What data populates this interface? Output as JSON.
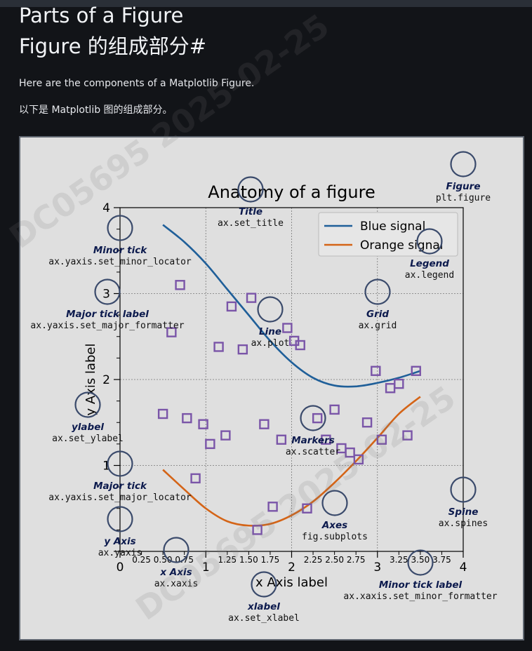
{
  "heading": {
    "title_en": "Parts of a Figure",
    "title_zh": "Figure 的组成部分#"
  },
  "paragraphs": {
    "en": "Here are the components of a Matplotlib Figure.",
    "zh": "以下是 Matplotlib 图的组成部分。"
  },
  "watermarks": [
    "DC05695 2025-02-25",
    "DC05695 2025-02-25"
  ],
  "colors": {
    "page_bg": "#121418",
    "figure_bg": "#dfdfdf",
    "blue": "#1f5f99",
    "orange": "#d46417",
    "marker": "#7a55a8",
    "annotation_circle": "#3a4a6b",
    "annotation_title": "#0c1a4d"
  },
  "chart_data": {
    "type": "line",
    "title": "Anatomy of a figure",
    "xlabel": "x Axis label",
    "ylabel": "y Axis label",
    "xlim": [
      0,
      4
    ],
    "ylim": [
      0,
      4
    ],
    "x_major_ticks": [
      "0",
      "1",
      "2",
      "3",
      "4"
    ],
    "x_minor_tick_labels": [
      "0.25",
      "0.50",
      "0.75",
      "1.25",
      "1.50",
      "1.75",
      "2.25",
      "2.50",
      "2.75",
      "3.25",
      "3.50",
      "3.75"
    ],
    "y_major_ticks": [
      "",
      "1",
      "2",
      "3",
      "4"
    ],
    "grid": true,
    "legend": {
      "placement": "top-right",
      "entries": [
        "Blue signal",
        "Orange signal"
      ]
    },
    "series": [
      {
        "name": "Blue signal",
        "color": "#1f5f99",
        "x": [
          0.5,
          0.75,
          1.0,
          1.25,
          1.5,
          1.75,
          2.0,
          2.25,
          2.5,
          2.75,
          3.0,
          3.25,
          3.5
        ],
        "y": [
          3.8,
          3.6,
          3.35,
          3.05,
          2.75,
          2.45,
          2.2,
          2.02,
          1.93,
          1.92,
          1.96,
          2.02,
          2.1
        ]
      },
      {
        "name": "Orange signal",
        "color": "#d46417",
        "x": [
          0.5,
          0.75,
          1.0,
          1.25,
          1.5,
          1.75,
          2.0,
          2.25,
          2.5,
          2.75,
          3.0,
          3.25,
          3.5
        ],
        "y": [
          0.95,
          0.72,
          0.5,
          0.35,
          0.3,
          0.32,
          0.42,
          0.58,
          0.8,
          1.05,
          1.32,
          1.6,
          1.8
        ]
      }
    ],
    "scatter": {
      "name": "Markers",
      "x": [
        0.5,
        0.6,
        0.7,
        0.78,
        0.88,
        0.97,
        1.05,
        1.15,
        1.23,
        1.3,
        1.43,
        1.53,
        1.6,
        1.68,
        1.78,
        1.88,
        1.95,
        2.03,
        2.1,
        2.18,
        2.3,
        2.4,
        2.5,
        2.58,
        2.68,
        2.78,
        2.88,
        2.98,
        3.05,
        3.15,
        3.25,
        3.35,
        3.45
      ],
      "y": [
        1.6,
        2.55,
        3.1,
        1.55,
        0.85,
        1.48,
        1.25,
        2.38,
        1.35,
        2.85,
        2.35,
        2.95,
        0.25,
        1.48,
        0.52,
        1.3,
        2.6,
        2.45,
        2.4,
        0.5,
        1.55,
        1.3,
        1.65,
        1.2,
        1.15,
        1.07,
        1.5,
        2.1,
        1.3,
        1.9,
        1.95,
        1.35,
        2.1
      ]
    },
    "annotations": [
      {
        "title": "Figure",
        "code": "plt.figure",
        "cx": 3.72,
        "cy": 4.05
      },
      {
        "title": "Title",
        "code": "ax.set_title",
        "cx": 1.44,
        "cy": 4.25
      },
      {
        "title": "Legend",
        "code": "ax.legend",
        "cx": 3.65,
        "cy": 3.85
      },
      {
        "title": "Minor tick",
        "code": "ax.yaxis.set_minor_locator",
        "cx": 0.0,
        "cy": 3.75
      },
      {
        "title": "Major tick label",
        "code": "ax.yaxis.set_major_formatter",
        "cx": -0.15,
        "cy": 3.0
      },
      {
        "title": "Grid",
        "code": "ax.grid",
        "cx": 3.0,
        "cy": 3.0
      },
      {
        "title": "Line",
        "code": "ax.plot",
        "cx": 1.75,
        "cy": 2.75
      },
      {
        "title": "ylabel",
        "code": "ax.set_ylabel",
        "cx": -0.4,
        "cy": 1.75
      },
      {
        "title": "Markers",
        "code": "ax.scatter",
        "cx": 2.25,
        "cy": 1.5
      },
      {
        "title": "Major tick",
        "code": "ax.yaxis.set_major_locator",
        "cx": 0.0,
        "cy": 1.0
      },
      {
        "title": "Axes",
        "code": "fig.subplots",
        "cx": 2.5,
        "cy": 0.5
      },
      {
        "title": "Spine",
        "code": "ax.spines",
        "cx": 4.0,
        "cy": 0.5
      },
      {
        "title": "y Axis",
        "code": "ax.yaxis",
        "cx": 0.0,
        "cy": 0.25
      },
      {
        "title": "x Axis",
        "code": "ax.xaxis",
        "cx": 0.65,
        "cy": -0.07
      },
      {
        "title": "Minor tick label",
        "code": "ax.xaxis.set_minor_formatter",
        "cx": 3.5,
        "cy": -0.07
      },
      {
        "title": "xlabel",
        "code": "ax.set_xlabel",
        "cx": 1.75,
        "cy": -0.3
      }
    ]
  }
}
